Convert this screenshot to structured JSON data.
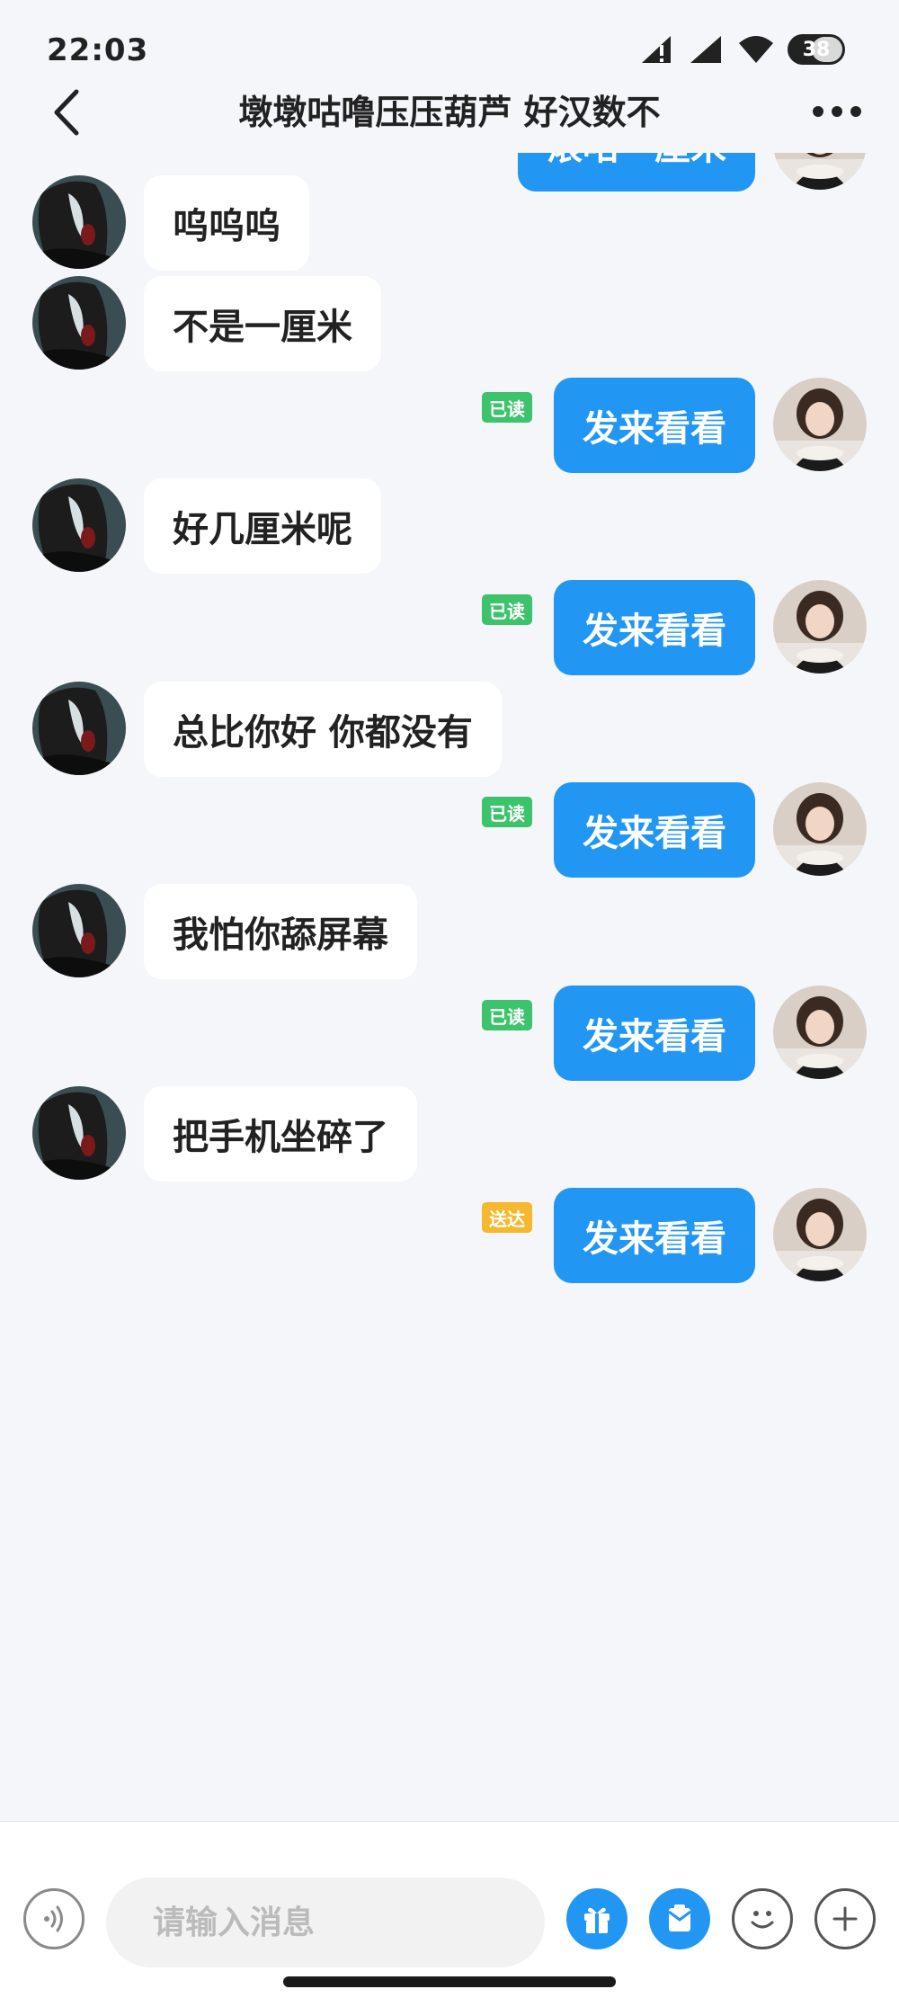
{
  "status_bar": {
    "time": "22:03",
    "battery": "38"
  },
  "header": {
    "title": "墩墩咕噜压压葫芦 好汉数不"
  },
  "messages": [
    {
      "side": "out",
      "text": "滚咕一厘米",
      "status": ""
    },
    {
      "side": "in",
      "text": "呜呜呜"
    },
    {
      "side": "in",
      "text": "不是一厘米"
    },
    {
      "side": "out",
      "text": "发来看看",
      "status": "已读"
    },
    {
      "side": "in",
      "text": "好几厘米呢"
    },
    {
      "side": "out",
      "text": "发来看看",
      "status": "已读"
    },
    {
      "side": "in",
      "text": "总比你好 你都没有"
    },
    {
      "side": "out",
      "text": "发来看看",
      "status": "已读"
    },
    {
      "side": "in",
      "text": "我怕你舔屏幕"
    },
    {
      "side": "out",
      "text": "发来看看",
      "status": "已读"
    },
    {
      "side": "in",
      "text": "把手机坐碎了"
    },
    {
      "side": "out",
      "text": "发来看看",
      "status": "送达"
    }
  ],
  "input": {
    "placeholder": "请输入消息"
  },
  "icons": {
    "back": "chevron-left-icon",
    "more": "more-dots-icon",
    "voice": "voice-icon",
    "gift": "gift-icon",
    "red_packet": "red-packet-icon",
    "emoji": "emoji-icon",
    "add": "plus-icon"
  },
  "colors": {
    "accent": "#2196f3",
    "read_tag": "#3cc36b",
    "delivered_tag": "#f5b82e",
    "background": "#f4f6f9"
  }
}
